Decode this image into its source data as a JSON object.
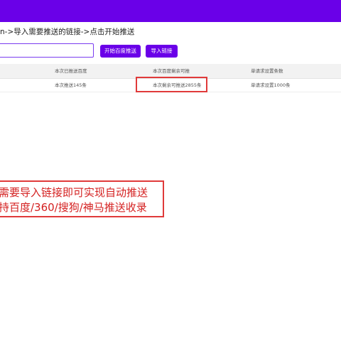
{
  "header": {
    "color": "#6a00e8"
  },
  "breadcrumb": {
    "text": "n->导入需要推送的链接->点击开始推送"
  },
  "form": {
    "url_input_value": "",
    "start_button_label": "开始百度推送",
    "import_button_label": "导入链接"
  },
  "table": {
    "columns": [
      "本次已推送百度",
      "本次百度剩余可推",
      "单请求设置条数"
    ],
    "rows": [
      [
        "本次推送145条",
        "本次剩余可推送2855条",
        "单请求设置1000条"
      ]
    ]
  },
  "annotation": {
    "line1": "需要导入链接即可实现自动推送",
    "line2": "持百度/360/搜狗/神马推送收录",
    "color": "#e03a3a"
  }
}
